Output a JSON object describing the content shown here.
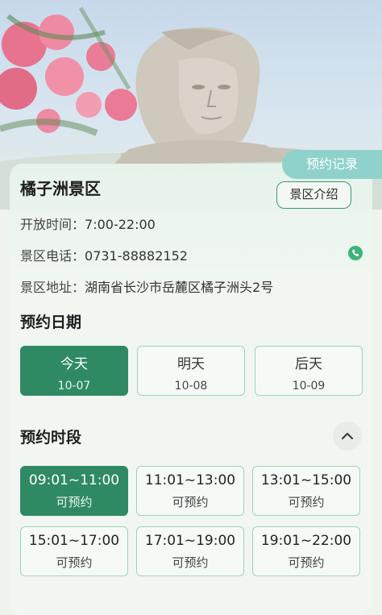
{
  "header": {
    "record_label": "预约记录"
  },
  "scenic": {
    "name": "橘子洲景区",
    "intro_label": "景区介绍",
    "hours_label": "开放时间：",
    "hours_value": "7:00-22:00",
    "phone_label": "景区电话：",
    "phone_value": "0731-88882152",
    "address_label": "景区地址：",
    "address_value": "湖南省长沙市岳麓区橘子洲头2号"
  },
  "date_section": {
    "title": "预约日期",
    "dates": [
      {
        "label": "今天",
        "date": "10-07",
        "selected": true
      },
      {
        "label": "明天",
        "date": "10-08",
        "selected": false
      },
      {
        "label": "后天",
        "date": "10-09",
        "selected": false
      }
    ]
  },
  "slot_section": {
    "title": "预约时段",
    "slots": [
      {
        "time": "09:01~11:00",
        "status": "可预约",
        "selected": true
      },
      {
        "time": "11:01~13:00",
        "status": "可预约",
        "selected": false
      },
      {
        "time": "13:01~15:00",
        "status": "可预约",
        "selected": false
      },
      {
        "time": "15:01~17:00",
        "status": "可预约",
        "selected": false
      },
      {
        "time": "17:01~19:00",
        "status": "可预约",
        "selected": false
      },
      {
        "time": "19:01~22:00",
        "status": "可预约",
        "selected": false
      }
    ]
  },
  "colors": {
    "accent": "#2f8a64",
    "record_button": "#8ed2cb",
    "phone_icon": "#3db37a"
  },
  "icons": {
    "phone": "phone-icon",
    "collapse": "chevron-up-icon"
  }
}
